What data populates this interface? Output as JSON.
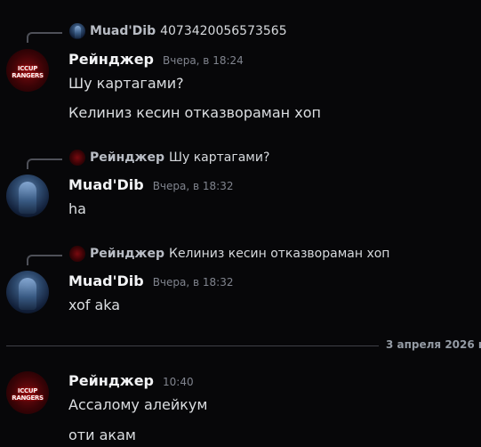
{
  "divider": {
    "date": "3 апреля 2026 г"
  },
  "messages": [
    {
      "reply": {
        "name": "Muad'Dib",
        "text": "4073420056573565"
      },
      "author": "Рейнджер",
      "time": "Вчера, в 18:24",
      "avatar": "iccup-rangers-logo",
      "avatar_text": "ICCUP RANGERS",
      "lines": [
        "Шу картагами?",
        "Келиниз кесин отказвораман хоп"
      ]
    },
    {
      "reply": {
        "name": "Рейнджер",
        "text": "Шу картагами?"
      },
      "author": "Muad'Dib",
      "time": "Вчера, в 18:32",
      "avatar": "muad-dib-figure",
      "lines": [
        "ha"
      ]
    },
    {
      "reply": {
        "name": "Рейнджер",
        "text": "Келиниз кесин отказвораман хоп"
      },
      "author": "Muad'Dib",
      "time": "Вчера, в 18:32",
      "avatar": "muad-dib-figure",
      "lines": [
        "xof aka"
      ]
    },
    {
      "author": "Рейнджер",
      "time": "10:40",
      "avatar": "iccup-rangers-logo",
      "avatar_text": "ICCUP RANGERS",
      "lines": [
        "Ассалому алейкум",
        "оти акам"
      ]
    }
  ],
  "colors": {
    "background": "#070709",
    "username": "#f2f3f5",
    "timestamp": "#80848e",
    "text": "#dbdee1"
  }
}
